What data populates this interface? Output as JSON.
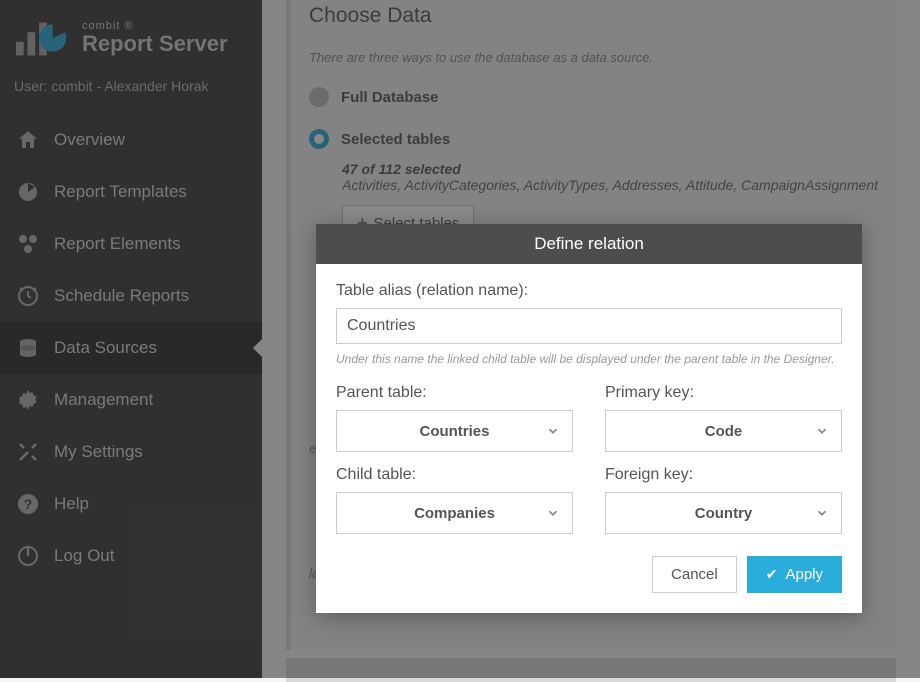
{
  "brand": {
    "sup": "combit ®",
    "main": "Report Server"
  },
  "user_line": "User: combit - Alexander Horak",
  "sidebar": {
    "items": [
      {
        "label": "Overview",
        "icon": "home-icon"
      },
      {
        "label": "Report Templates",
        "icon": "pie-icon"
      },
      {
        "label": "Report Elements",
        "icon": "elements-icon"
      },
      {
        "label": "Schedule Reports",
        "icon": "clock-icon"
      },
      {
        "label": "Data Sources",
        "icon": "database-icon"
      },
      {
        "label": "Management",
        "icon": "gear-icon"
      },
      {
        "label": "My Settings",
        "icon": "tools-icon"
      },
      {
        "label": "Help",
        "icon": "help-icon"
      },
      {
        "label": "Log Out",
        "icon": "logout-icon"
      }
    ],
    "active_index": 4
  },
  "main": {
    "panel_title": "Choose Data",
    "panel_sub": "There are three ways to use the database as a data source.",
    "opt_full": "Full Database",
    "opt_selected": "Selected tables",
    "selected_count": "47 of 112 selected",
    "selected_list": "Activities, ActivityCategories, ActivityTypes, Addresses, Attitude, CampaignAssignment, Cam",
    "select_tables_btn": "Select tables",
    "schema_hint": "ed schema n",
    "rel_hint": "lations of t"
  },
  "dialog": {
    "title": "Define relation",
    "alias_label": "Table alias (relation name):",
    "alias_value": "Countries",
    "alias_hint": "Under this name the linked child table will be displayed under the parent table in the Designer.",
    "parent_table_label": "Parent table:",
    "primary_key_label": "Primary key:",
    "child_table_label": "Child table:",
    "foreign_key_label": "Foreign key:",
    "parent_table": "Countries",
    "primary_key": "Code",
    "child_table": "Companies",
    "foreign_key": "Country",
    "cancel": "Cancel",
    "apply": "Apply"
  },
  "colors": {
    "accent": "#29aedb"
  }
}
